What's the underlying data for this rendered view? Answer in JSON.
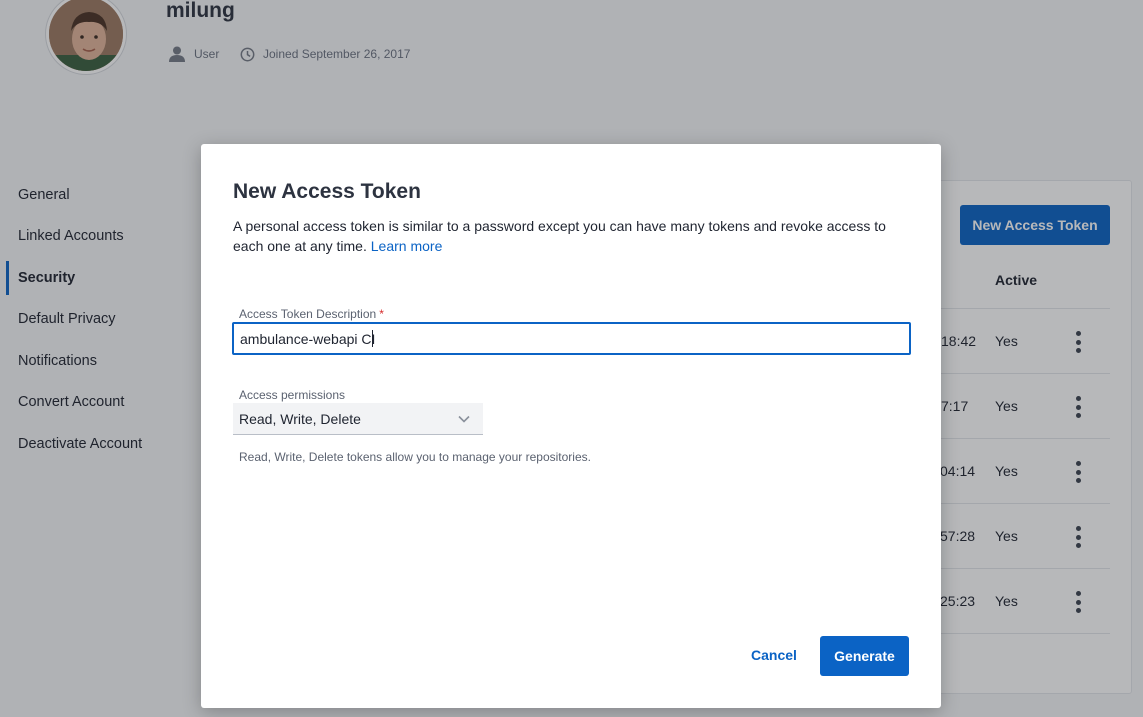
{
  "profile": {
    "username": "milung",
    "role": "User",
    "joined": "Joined September 26, 2017"
  },
  "sidebar": {
    "items": [
      {
        "label": "General",
        "active": false
      },
      {
        "label": "Linked Accounts",
        "active": false
      },
      {
        "label": "Security",
        "active": true
      },
      {
        "label": "Default Privacy",
        "active": false
      },
      {
        "label": "Notifications",
        "active": false
      },
      {
        "label": "Convert Account",
        "active": false
      },
      {
        "label": "Deactivate Account",
        "active": false
      }
    ]
  },
  "tokens": {
    "new_token_label": "New Access Token",
    "active_header": "Active",
    "rows": [
      {
        "last_used_partial": "18:42",
        "active": "Yes"
      },
      {
        "last_used_partial": "7:17",
        "active": "Yes"
      },
      {
        "last_used_partial": "04:14",
        "active": "Yes"
      },
      {
        "last_used_partial": "57:28",
        "active": "Yes"
      },
      {
        "last_used_partial": "25:23",
        "active": "Yes"
      }
    ]
  },
  "modal": {
    "title": "New Access Token",
    "description": "A personal access token is similar to a password except you can have many tokens and revoke access to each one at any time.",
    "learn_more": "Learn more",
    "description_field": {
      "label": "Access Token Description",
      "required_marker": "*",
      "value": "ambulance-webapi CI"
    },
    "permissions_field": {
      "label": "Access permissions",
      "selected": "Read, Write, Delete",
      "help": "Read, Write, Delete tokens allow you to manage your repositories."
    },
    "cancel_label": "Cancel",
    "generate_label": "Generate"
  },
  "colors": {
    "accent": "#0b63c5",
    "required": "#d62b2b",
    "overlay": "rgba(30,34,40,0.32)"
  },
  "icons": {
    "role": "person-icon",
    "joined": "clock-icon",
    "select": "chevron-down-icon",
    "row_menu": "kebab-menu-icon"
  }
}
